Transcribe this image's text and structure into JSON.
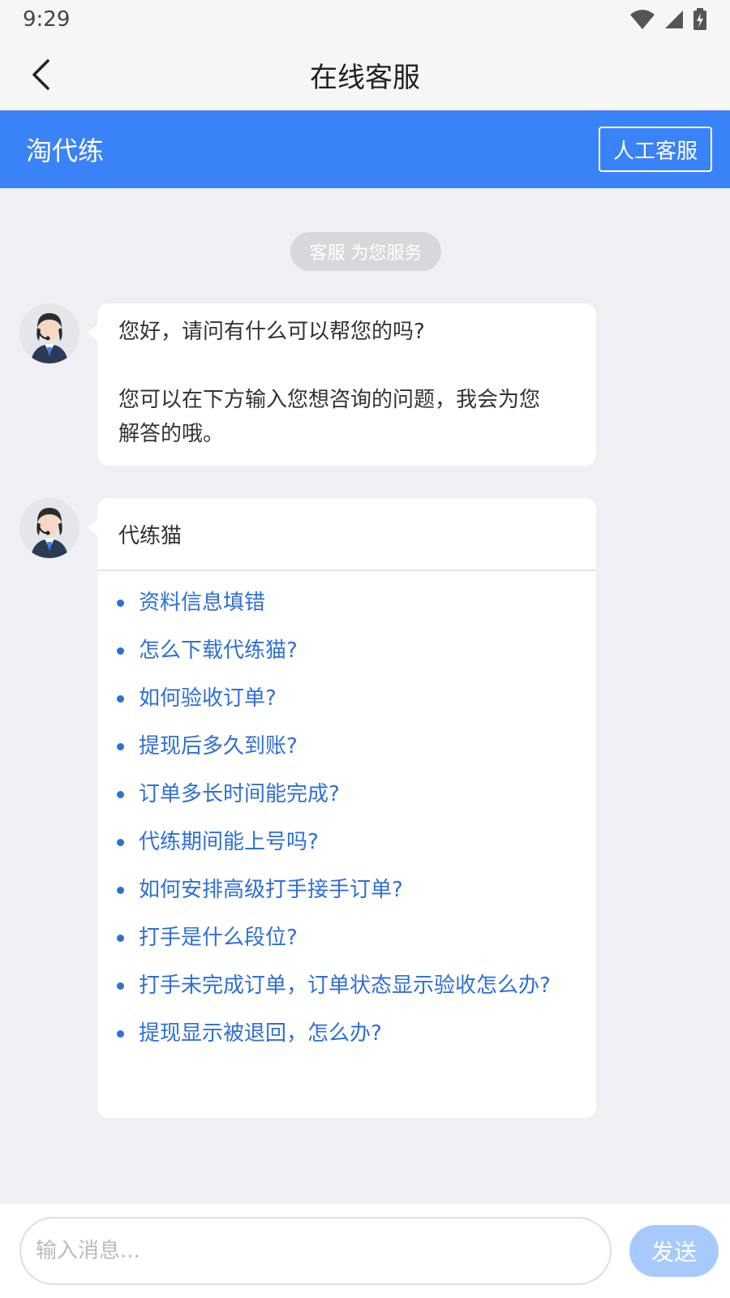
{
  "status_bar": {
    "time": "9:29",
    "icons": [
      "wifi-icon",
      "signal-icon",
      "battery-charging-icon"
    ]
  },
  "nav": {
    "back_icon": "chevron-left-icon",
    "title": "在线客服"
  },
  "brand_bar": {
    "name": "淘代练",
    "human_service_label": "人工客服",
    "color": "#3a82f8"
  },
  "chat": {
    "system_notice": "客服 为您服务",
    "messages": [
      {
        "sender": "agent",
        "avatar_icon": "customer-service-avatar-icon",
        "line1": "您好，请问有什么可以帮您的吗?",
        "line2": "您可以在下方输入您想咨询的问题，我会为您",
        "line3": "解答的哦。"
      },
      {
        "sender": "agent",
        "avatar_icon": "customer-service-avatar-icon",
        "title": "代练猫",
        "faq": [
          "资料信息填错",
          "怎么下载代练猫?",
          "如何验收订单?",
          "提现后多久到账?",
          "订单多长时间能完成?",
          "代练期间能上号吗?",
          "如何安排高级打手接手订单?",
          "打手是什么段位?",
          "打手未完成订单，订单状态显示验收怎么办?",
          "提现显示被退回，怎么办?"
        ]
      }
    ]
  },
  "input_bar": {
    "placeholder": "输入消息...",
    "value": "",
    "send_label": "发送",
    "send_color": "#a8c9fb"
  }
}
